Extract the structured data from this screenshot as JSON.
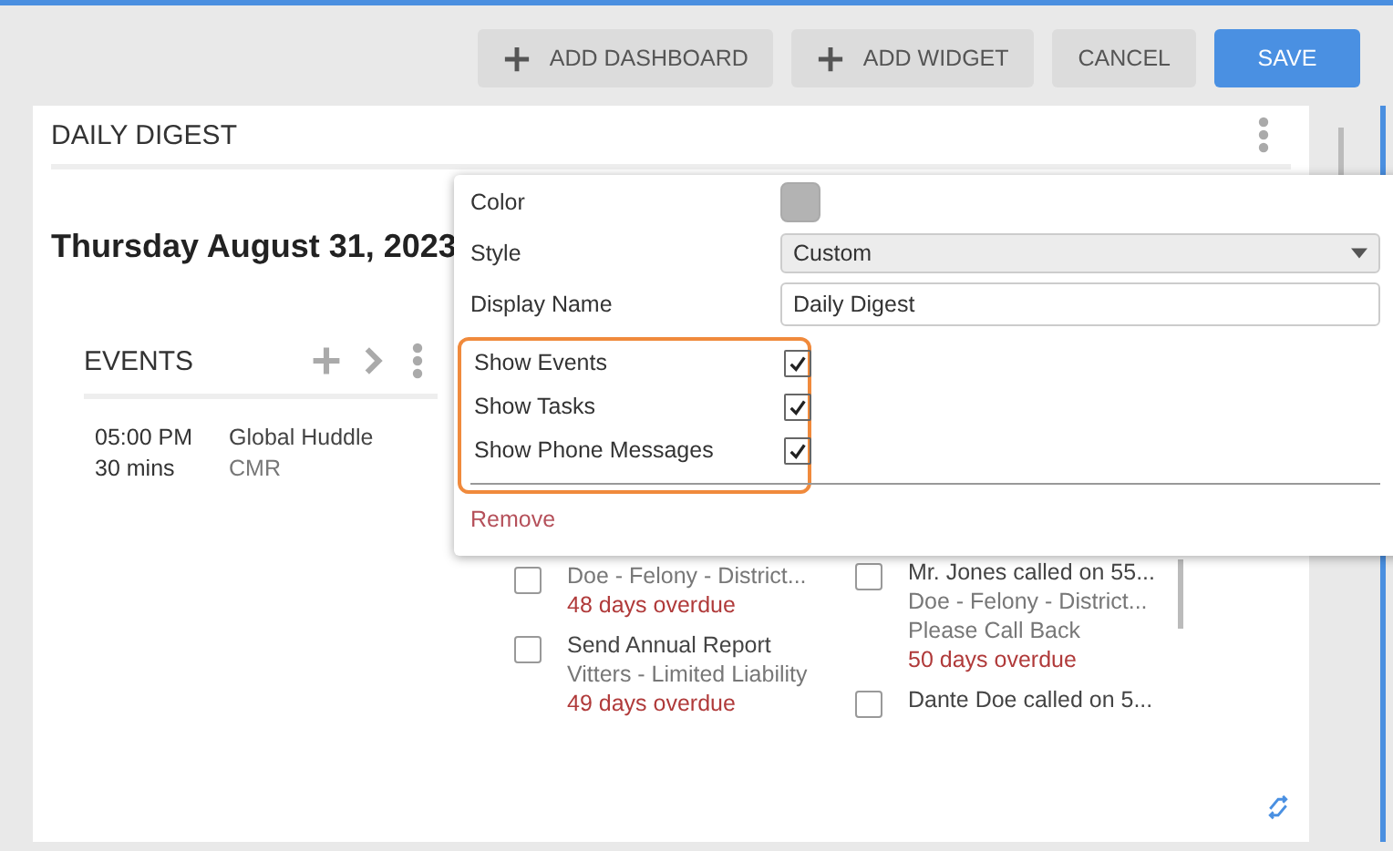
{
  "toolbar": {
    "buttons": [
      {
        "label": "ADD DASHBOARD",
        "kind": "add"
      },
      {
        "label": "ADD WIDGET",
        "kind": "add"
      },
      {
        "label": "CANCEL",
        "kind": "plain"
      },
      {
        "label": "SAVE",
        "kind": "primary"
      }
    ]
  },
  "widget": {
    "title": "DAILY DIGEST",
    "date": "Thursday August 31, 2023",
    "events": {
      "title": "EVENTS",
      "items": [
        {
          "time": "05:00 PM",
          "duration": "30 mins",
          "name": "Global Huddle",
          "location": "CMR"
        }
      ]
    },
    "tasks": [
      {
        "subtitle": "Doe - Felony - District...",
        "due": "48 days overdue",
        "checked": false
      },
      {
        "title": "Send Annual Report",
        "subtitle": "Vitters - Limited Liability",
        "due": "49 days overdue",
        "checked": false
      }
    ],
    "messages": [
      {
        "title": "Mr. Jones called on 55...",
        "subtitle": "Doe - Felony - District...",
        "note": "Please Call Back",
        "due": "50 days overdue",
        "checked": false
      },
      {
        "title": "Dante Doe called on 5...",
        "checked": false
      }
    ]
  },
  "settings": {
    "color_label": "Color",
    "color": "#b3b3b3",
    "style_label": "Style",
    "style_value": "Custom",
    "name_label": "Display Name",
    "name_value": "Daily Digest",
    "toggles": [
      {
        "label": "Show Events",
        "checked": true
      },
      {
        "label": "Show Tasks",
        "checked": true
      },
      {
        "label": "Show Phone Messages",
        "checked": true
      }
    ],
    "remove": "Remove"
  }
}
